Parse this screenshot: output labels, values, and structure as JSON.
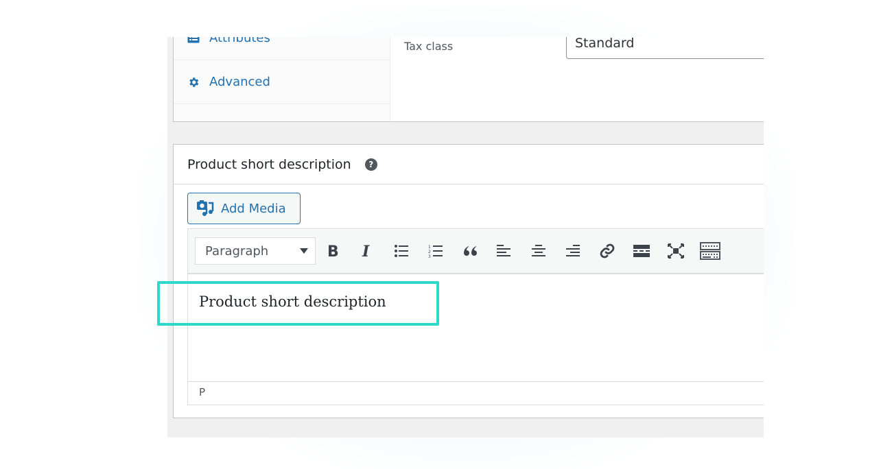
{
  "product_data": {
    "tabs": [
      {
        "label": "Attributes",
        "icon": "attributes-icon"
      },
      {
        "label": "Advanced",
        "icon": "gear-icon"
      }
    ],
    "tax_class_label": "Tax class",
    "tax_class_value": "Standard"
  },
  "short_description": {
    "title": "Product short description",
    "help_icon": "help-icon",
    "help_glyph": "?",
    "add_media_label": "Add Media",
    "editor": {
      "format_select_value": "Paragraph",
      "toolbar_buttons": [
        {
          "name": "bold",
          "label": "B"
        },
        {
          "name": "italic",
          "label": "I"
        },
        {
          "name": "bullet-list"
        },
        {
          "name": "numbered-list"
        },
        {
          "name": "blockquote"
        },
        {
          "name": "align-left"
        },
        {
          "name": "align-center"
        },
        {
          "name": "align-right"
        },
        {
          "name": "insert-link"
        },
        {
          "name": "read-more"
        },
        {
          "name": "fullscreen"
        },
        {
          "name": "toolbar-toggle"
        }
      ],
      "content": "Product short description",
      "path": "P"
    }
  },
  "colors": {
    "accent": "#2271b1",
    "highlight": "#2dd8c8",
    "icon": "#3c434a"
  }
}
